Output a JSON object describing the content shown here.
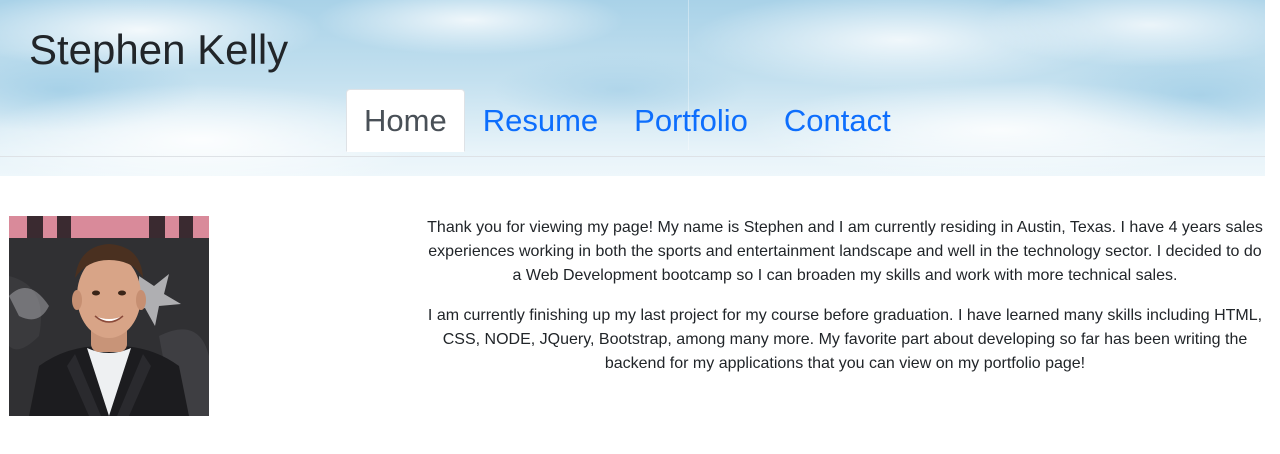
{
  "site": {
    "title": "Stephen Kelly"
  },
  "nav": {
    "items": [
      {
        "label": "Home",
        "active": true
      },
      {
        "label": "Resume",
        "active": false
      },
      {
        "label": "Portfolio",
        "active": false
      },
      {
        "label": "Contact",
        "active": false
      }
    ]
  },
  "about": {
    "paragraphs": [
      "Thank you for viewing my page! My name is Stephen and I am currently residing in Austin, Texas. I have 4 years sales experiences working in both the sports and entertainment landscape and well in the technology sector. I decided to do a Web Development bootcamp so I can broaden my skills and work with more technical sales.",
      "I am currently finishing up my last project for my course before graduation. I have learned many skills including HTML, CSS, NODE, JQuery, Bootstrap, among many more. My favorite part about developing so far has been writing the backend for my applications that you can view on my portfolio page!"
    ]
  },
  "colors": {
    "link": "#0d6efd",
    "active_tab_text": "#495057",
    "body_text": "#212529",
    "sky_blue": "#a9d2e8"
  }
}
